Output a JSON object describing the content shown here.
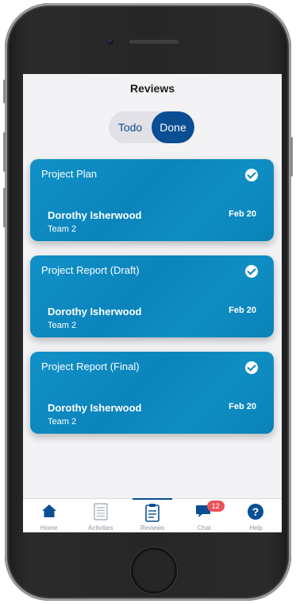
{
  "screen": {
    "title": "Reviews"
  },
  "segment": {
    "todo_label": "Todo",
    "done_label": "Done",
    "active": "Done"
  },
  "cards": [
    {
      "title": "Project Plan",
      "name": "Dorothy Isherwood",
      "team": "Team 2",
      "date": "Feb 20",
      "status_icon": "check-circle-icon"
    },
    {
      "title": "Project Report (Draft)",
      "name": "Dorothy Isherwood",
      "team": "Team 2",
      "date": "Feb 20",
      "status_icon": "check-circle-icon"
    },
    {
      "title": "Project Report (Final)",
      "name": "Dorothy Isherwood",
      "team": "Team 2",
      "date": "Feb 20",
      "status_icon": "check-circle-icon"
    }
  ],
  "tabs": [
    {
      "label": "Home",
      "icon": "home-icon"
    },
    {
      "label": "Activities",
      "icon": "list-icon"
    },
    {
      "label": "Reviews",
      "icon": "clipboard-icon"
    },
    {
      "label": "Chat",
      "icon": "chat-icon",
      "badge": "12"
    },
    {
      "label": "Help",
      "icon": "help-icon"
    }
  ],
  "colors": {
    "primary": "#0a4e93",
    "card": "#0b84bc",
    "badge": "#e8535a"
  }
}
